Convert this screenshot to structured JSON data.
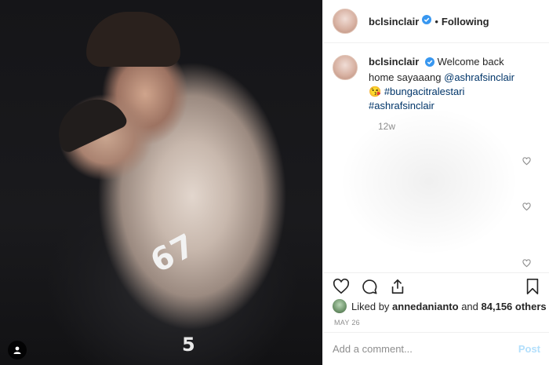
{
  "post": {
    "username": "bclsinclair",
    "follow_status": "Following",
    "separator": "•"
  },
  "caption": {
    "username": "bclsinclair",
    "text_before": "Welcome back home sayaaang ",
    "mention": "@ashrafsinclair",
    "emoji": "😘",
    "hashtags": "#bungacitralestari #ashrafsinclair",
    "time_ago": "12w"
  },
  "photo": {
    "jersey_number": "67",
    "jersey_number_small": "5"
  },
  "likes": {
    "prefix": "Liked by ",
    "first_user": "annedanianto",
    "middle": " and ",
    "count": "84,156 others"
  },
  "date": "MAY 26",
  "comment": {
    "placeholder": "Add a comment...",
    "post_label": "Post"
  },
  "icons": {
    "verified": "verified-badge-icon",
    "heart": "heart-icon",
    "comment": "comment-icon",
    "share": "share-icon",
    "save": "bookmark-icon",
    "tag": "user-tag-icon"
  },
  "colors": {
    "verified": "#3897f0",
    "link": "#003569",
    "post_button": "#b2dffc",
    "muted": "#8e8e8e"
  }
}
